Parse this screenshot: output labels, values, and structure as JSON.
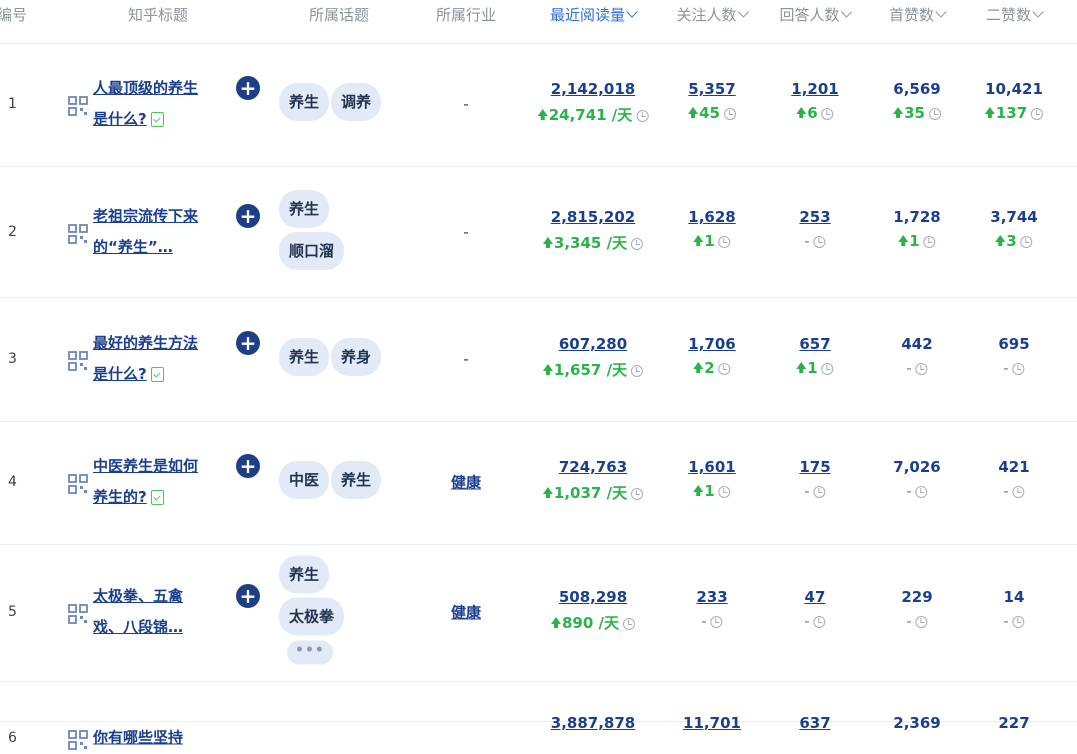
{
  "headers": [
    {
      "label": "编号"
    },
    {
      "label": "知乎标题"
    },
    {
      "label": "所属话题"
    },
    {
      "label": "所属行业"
    },
    {
      "label": "最近阅读量"
    },
    {
      "label": "关注人数"
    },
    {
      "label": "回答人数"
    },
    {
      "label": "首赞数"
    },
    {
      "label": "二赞数"
    }
  ],
  "colors": {
    "accent": "#2e6fd8",
    "link": "#1b3f8f",
    "increase": "#2bb34a",
    "tag_bg": "#e3eaf7"
  },
  "rows": [
    {
      "num": "1",
      "title": "人最顶级的养生是什么?",
      "doc_icon": true,
      "topics": [
        "养生",
        "调养"
      ],
      "industry": "-",
      "reads": "2,142,018",
      "reads_delta": "24,741 /天",
      "follow": "5,357",
      "follow_delta": "45",
      "answers": "1,201",
      "answers_delta": "6",
      "first_likes": "6,569",
      "first_delta": "35",
      "second_likes": "10,421",
      "second_delta": "137"
    },
    {
      "num": "2",
      "title": "老祖宗流传下来的“养生”…",
      "doc_icon": false,
      "topics": [
        "养生",
        "顺口溜"
      ],
      "industry": "-",
      "reads": "2,815,202",
      "reads_delta": "3,345 /天",
      "follow": "1,628",
      "follow_delta": "1",
      "answers": "253",
      "answers_delta": "-",
      "first_likes": "1,728",
      "first_delta": "1",
      "second_likes": "3,744",
      "second_delta": "3"
    },
    {
      "num": "3",
      "title": "最好的养生方法是什么?",
      "doc_icon": true,
      "topics": [
        "养生",
        "养身"
      ],
      "industry": "-",
      "reads": "607,280",
      "reads_delta": "1,657 /天",
      "follow": "1,706",
      "follow_delta": "2",
      "answers": "657",
      "answers_delta": "1",
      "first_likes": "442",
      "first_delta": "-",
      "second_likes": "695",
      "second_delta": "-"
    },
    {
      "num": "4",
      "title": "中医养生是如何养生的?",
      "doc_icon": true,
      "topics": [
        "中医",
        "养生"
      ],
      "industry": "健康",
      "reads": "724,763",
      "reads_delta": "1,037 /天",
      "follow": "1,601",
      "follow_delta": "1",
      "answers": "175",
      "answers_delta": "-",
      "first_likes": "7,026",
      "first_delta": "-",
      "second_likes": "421",
      "second_delta": "-"
    },
    {
      "num": "5",
      "title": "太极拳、五禽戏、八段锦…",
      "doc_icon": false,
      "topics": [
        "养生",
        "太极拳"
      ],
      "more_tag": "•••",
      "industry": "健康",
      "reads": "508,298",
      "reads_delta": "890 /天",
      "follow": "233",
      "follow_delta": "-",
      "answers": "47",
      "answers_delta": "-",
      "first_likes": "229",
      "first_delta": "-",
      "second_likes": "14",
      "second_delta": "-"
    },
    {
      "num": "6",
      "title": "你有哪些坚持",
      "doc_icon": false,
      "topics": [],
      "industry": "",
      "reads": "3,887,878",
      "reads_delta": "",
      "follow": "11,701",
      "follow_delta": "",
      "answers": "637",
      "answers_delta": "",
      "first_likes": "2,369",
      "first_delta": "",
      "second_likes": "227",
      "second_delta": ""
    }
  ]
}
